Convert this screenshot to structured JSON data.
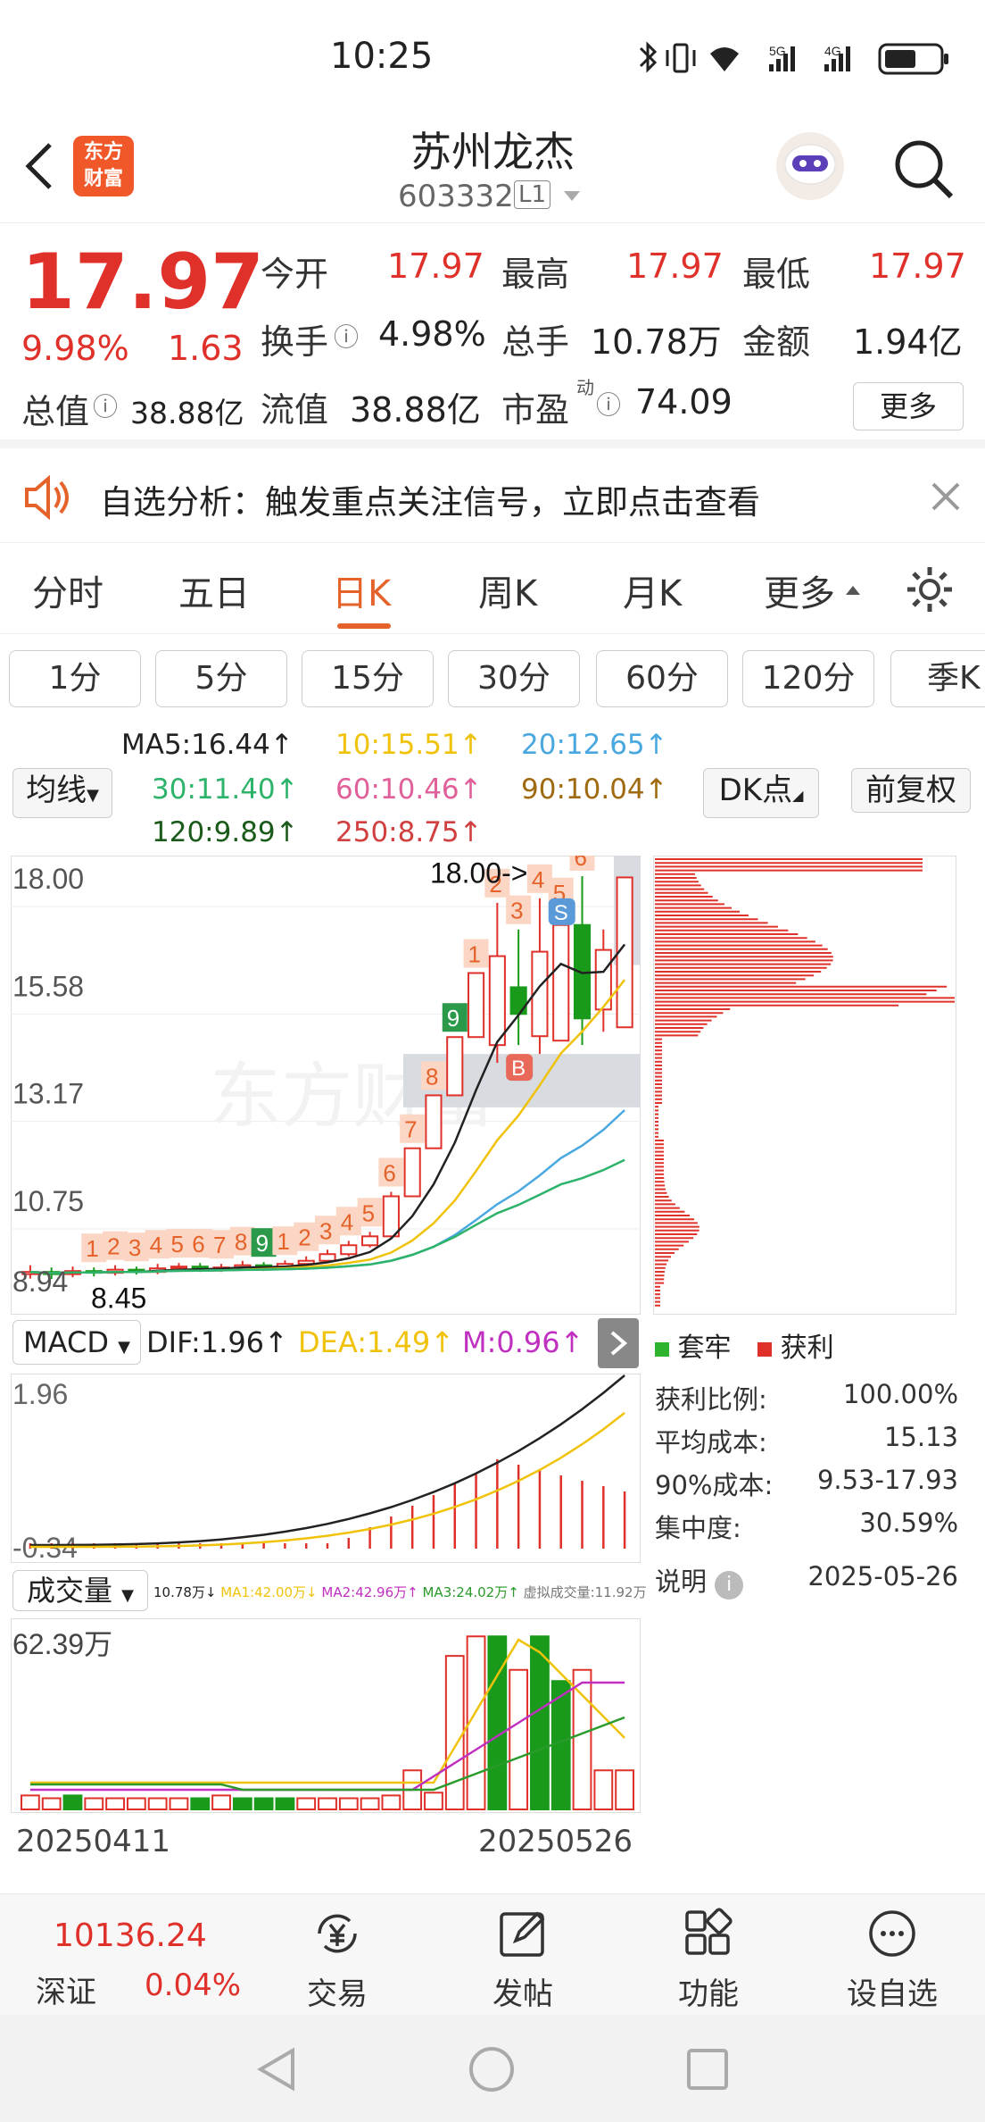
{
  "status_bar": {
    "time": "10:25",
    "signal_labels": [
      "5G",
      "4G"
    ]
  },
  "header": {
    "logo_line1": "东方",
    "logo_line2": "财富",
    "stock_name": "苏州龙杰",
    "stock_code": "603332",
    "level_badge": "L1"
  },
  "quote": {
    "price": "17.97",
    "change_pct": "9.98%",
    "change": "1.63",
    "labels": {
      "open": "今开",
      "high": "最高",
      "low": "最低",
      "turnover": "换手",
      "volume": "总手",
      "amount": "金额",
      "total_cap": "总值",
      "float_cap": "流值",
      "pe": "市盈",
      "pe_sup": "动"
    },
    "open": "17.97",
    "high": "17.97",
    "low": "17.97",
    "turnover": "4.98%",
    "volume": "10.78万",
    "amount": "1.94亿",
    "total_cap": "38.88亿",
    "float_cap": "38.88亿",
    "pe": "74.09",
    "more_button": "更多"
  },
  "notice": {
    "text": "自选分析：触发重点关注信号，立即点击查看"
  },
  "tabs": [
    "分时",
    "五日",
    "日K",
    "周K",
    "月K",
    "更多"
  ],
  "active_tab": "日K",
  "periods": [
    "1分",
    "5分",
    "15分",
    "30分",
    "60分",
    "120分",
    "季K"
  ],
  "indicator_select": "均线",
  "dk_select": "DK点",
  "adjust_button": "前复权",
  "ma_labels": {
    "ma5": "MA5:16.44↑",
    "ma10": "10:15.51↑",
    "ma20": "20:12.65↑",
    "ma30": "30:11.40↑",
    "ma60": "60:10.46↑",
    "ma90": "90:10.04↑",
    "ma120": "120:9.89↑",
    "ma250": "250:8.75↑"
  },
  "colors": {
    "up": "#e0302a",
    "down": "#1a9a1a",
    "accent": "#e5632a",
    "ma5": "#222222",
    "ma10": "#f0c20a",
    "ma20": "#4aa8e0",
    "ma30": "#2db36a",
    "ma60": "#e0609a",
    "ma90": "#a06a10",
    "ma120": "#1a5a1a",
    "ma250": "#d04040"
  },
  "chart_data": {
    "type": "candlestick",
    "y_ticks": [
      "18.00",
      "15.58",
      "13.17",
      "10.75",
      "8.94"
    ],
    "high_marker": "18.00->",
    "low_marker": "8.45",
    "candles": [
      {
        "o": 9.05,
        "c": 9.1,
        "h": 9.25,
        "l": 8.95
      },
      {
        "o": 9.1,
        "c": 9.05,
        "h": 9.2,
        "l": 8.94
      },
      {
        "o": 9.05,
        "c": 9.12,
        "h": 9.22,
        "l": 8.98
      },
      {
        "o": 9.12,
        "c": 9.08,
        "h": 9.2,
        "l": 9.0
      },
      {
        "o": 9.08,
        "c": 9.15,
        "h": 9.25,
        "l": 9.02
      },
      {
        "o": 9.15,
        "c": 9.1,
        "h": 9.22,
        "l": 9.04
      },
      {
        "o": 9.1,
        "c": 9.18,
        "h": 9.28,
        "l": 9.05
      },
      {
        "o": 9.18,
        "c": 9.22,
        "h": 9.3,
        "l": 9.1
      },
      {
        "o": 9.22,
        "c": 9.16,
        "h": 9.3,
        "l": 9.1
      },
      {
        "o": 9.16,
        "c": 9.2,
        "h": 9.28,
        "l": 9.1
      },
      {
        "o": 9.2,
        "c": 9.25,
        "h": 9.35,
        "l": 9.15
      },
      {
        "o": 9.25,
        "c": 9.2,
        "h": 9.32,
        "l": 9.12
      },
      {
        "o": 9.2,
        "c": 9.28,
        "h": 9.36,
        "l": 9.15
      },
      {
        "o": 9.28,
        "c": 9.35,
        "h": 9.45,
        "l": 9.22
      },
      {
        "o": 9.35,
        "c": 9.5,
        "h": 9.6,
        "l": 9.3
      },
      {
        "o": 9.5,
        "c": 9.7,
        "h": 9.8,
        "l": 9.45
      },
      {
        "o": 9.7,
        "c": 9.9,
        "h": 10.0,
        "l": 9.65
      },
      {
        "o": 9.9,
        "c": 10.8,
        "h": 10.9,
        "l": 9.85
      },
      {
        "o": 10.8,
        "c": 11.88,
        "h": 11.88,
        "l": 10.8
      },
      {
        "o": 11.88,
        "c": 13.07,
        "h": 13.07,
        "l": 11.88
      },
      {
        "o": 13.07,
        "c": 14.38,
        "h": 14.38,
        "l": 13.07
      },
      {
        "o": 14.38,
        "c": 15.82,
        "h": 15.82,
        "l": 14.38
      },
      {
        "o": 14.2,
        "c": 16.2,
        "h": 17.4,
        "l": 13.8
      },
      {
        "o": 15.5,
        "c": 14.9,
        "h": 16.8,
        "l": 14.2
      },
      {
        "o": 14.4,
        "c": 16.3,
        "h": 17.5,
        "l": 14.0
      },
      {
        "o": 14.3,
        "c": 16.9,
        "h": 17.2,
        "l": 14.3
      },
      {
        "o": 16.9,
        "c": 14.8,
        "h": 18.0,
        "l": 14.2
      },
      {
        "o": 15.0,
        "c": 16.34,
        "h": 16.8,
        "l": 14.5
      },
      {
        "o": 14.6,
        "c": 17.97,
        "h": 17.97,
        "l": 14.6
      }
    ],
    "signal_labels": [
      "1",
      "2",
      "3",
      "4",
      "5",
      "6",
      "7",
      "8",
      "9",
      "1",
      "2",
      "3",
      "4",
      "5",
      "6",
      "7",
      "8",
      "9",
      "1",
      "2",
      "3",
      "4",
      "5",
      "6"
    ],
    "trade_marks": [
      "S",
      "B"
    ]
  },
  "chip_legend": {
    "trapped": "套牢",
    "profit": "获利"
  },
  "chip_stats": [
    {
      "label": "获利比例:",
      "value": "100.00%"
    },
    {
      "label": "平均成本:",
      "value": "15.13"
    },
    {
      "label": "90%成本:",
      "value": "9.53-17.93"
    },
    {
      "label": "集中度:",
      "value": "30.59%"
    }
  ],
  "chip_footer": {
    "explain": "说明",
    "date": "2025-05-26"
  },
  "macd": {
    "select": "MACD",
    "dif": "DIF:1.96↑",
    "dea": "DEA:1.49↑",
    "m": "M:0.96↑",
    "top": "1.96",
    "bottom": "-0.34"
  },
  "volume": {
    "select": "成交量",
    "legend": [
      "10.78万↓",
      "MA1:42.00万↓",
      "MA2:42.96万↑",
      "MA3:24.02万↑",
      "虚拟成交量:11.92万"
    ],
    "top": "62.39万",
    "date_start": "20250411",
    "date_end": "20250526"
  },
  "bottom_bar": {
    "index_value": "10136.24",
    "index_name": "深证",
    "index_change": "0.04%",
    "items": [
      "交易",
      "发帖",
      "功能",
      "设自选"
    ]
  }
}
